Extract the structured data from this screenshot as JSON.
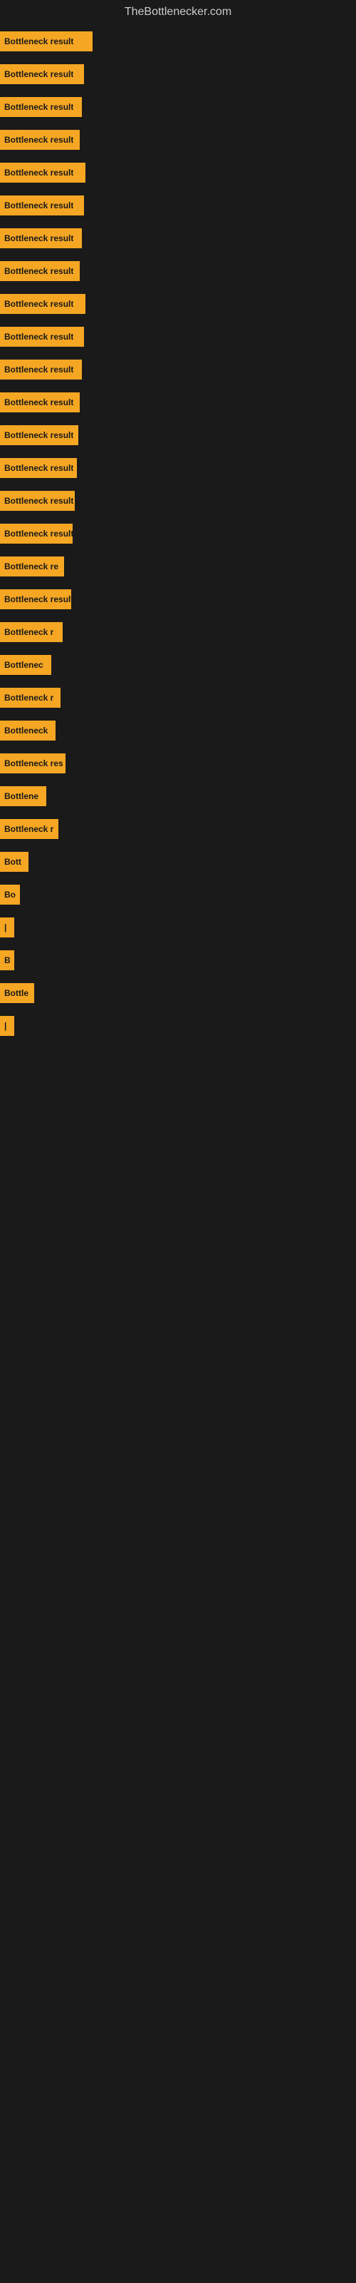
{
  "site_title": "TheBottlenecker.com",
  "bars": [
    {
      "label": "Bottleneck result",
      "width": 130
    },
    {
      "label": "Bottleneck result",
      "width": 118
    },
    {
      "label": "Bottleneck result",
      "width": 115
    },
    {
      "label": "Bottleneck result",
      "width": 112
    },
    {
      "label": "Bottleneck result",
      "width": 120
    },
    {
      "label": "Bottleneck result",
      "width": 118
    },
    {
      "label": "Bottleneck result",
      "width": 115
    },
    {
      "label": "Bottleneck result",
      "width": 112
    },
    {
      "label": "Bottleneck result",
      "width": 120
    },
    {
      "label": "Bottleneck result",
      "width": 118
    },
    {
      "label": "Bottleneck result",
      "width": 115
    },
    {
      "label": "Bottleneck result",
      "width": 112
    },
    {
      "label": "Bottleneck result",
      "width": 110
    },
    {
      "label": "Bottleneck result",
      "width": 108
    },
    {
      "label": "Bottleneck result",
      "width": 105
    },
    {
      "label": "Bottleneck result",
      "width": 102
    },
    {
      "label": "Bottleneck re",
      "width": 90
    },
    {
      "label": "Bottleneck result",
      "width": 100
    },
    {
      "label": "Bottleneck r",
      "width": 88
    },
    {
      "label": "Bottlenec",
      "width": 72
    },
    {
      "label": "Bottleneck r",
      "width": 85
    },
    {
      "label": "Bottleneck",
      "width": 78
    },
    {
      "label": "Bottleneck res",
      "width": 92
    },
    {
      "label": "Bottlene",
      "width": 65
    },
    {
      "label": "Bottleneck r",
      "width": 82
    },
    {
      "label": "Bott",
      "width": 40
    },
    {
      "label": "Bo",
      "width": 28
    },
    {
      "label": "|",
      "width": 8
    },
    {
      "label": "B",
      "width": 18
    },
    {
      "label": "Bottle",
      "width": 48
    },
    {
      "label": "|",
      "width": 6
    }
  ]
}
